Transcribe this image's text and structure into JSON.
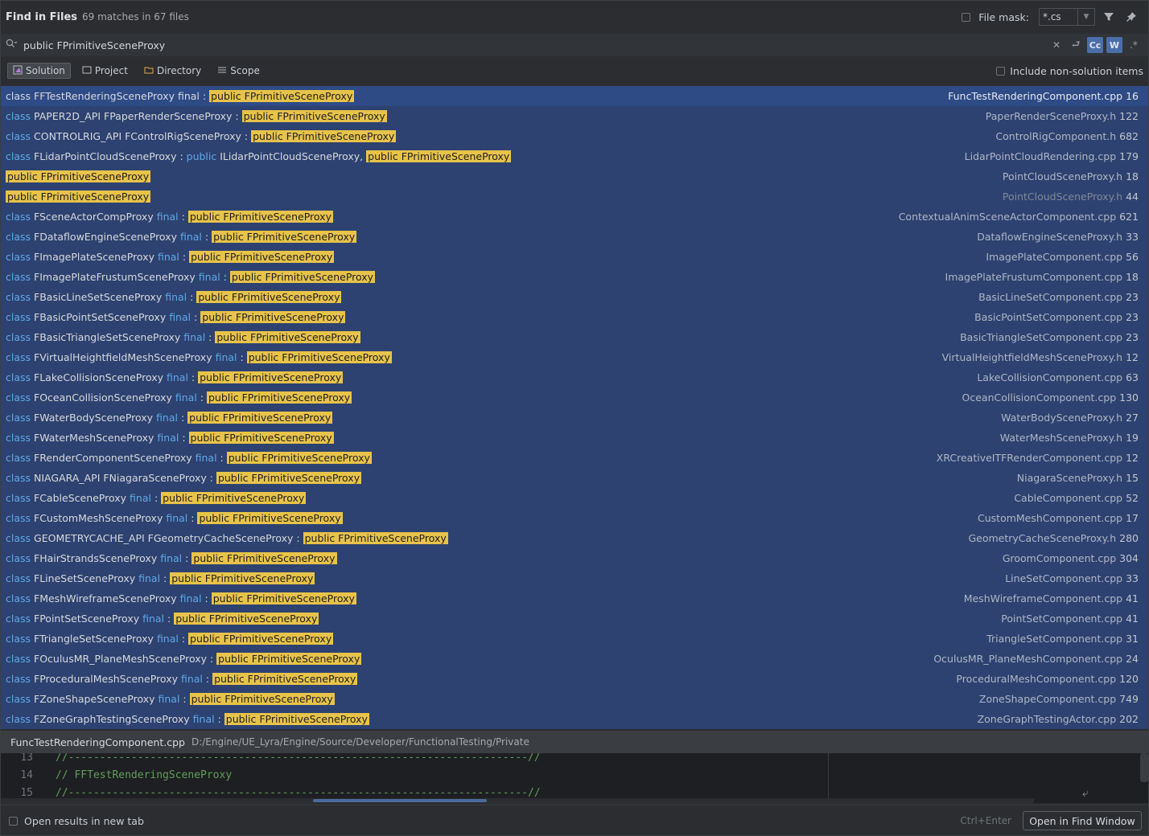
{
  "header": {
    "title": "Find in Files",
    "match_count": "69 matches in 67 files",
    "file_mask_label": "File mask:",
    "file_mask_value": "*.cs"
  },
  "search": {
    "query": "public FPrimitiveSceneProxy",
    "case_toggle": "Cc",
    "words_toggle": "W",
    "regex_toggle": ".*"
  },
  "scopes": [
    {
      "label": "Solution",
      "active": true,
      "icon": "solution-icon"
    },
    {
      "label": "Project",
      "active": false,
      "icon": "project-icon"
    },
    {
      "label": "Directory",
      "active": false,
      "icon": "folder-icon"
    },
    {
      "label": "Scope",
      "active": false,
      "icon": "scope-icon"
    }
  ],
  "include_non_solution": "Include non-solution items",
  "highlight": "public FPrimitiveSceneProxy",
  "results": [
    {
      "pre": [
        [
          "class ",
          "p"
        ],
        [
          "FFTestRenderingSceneProxy final : ",
          "p"
        ]
      ],
      "post": [],
      "file": "FuncTestRenderingComponent.cpp",
      "line": "16",
      "selected": true
    },
    {
      "pre": [
        [
          "class ",
          "k"
        ],
        [
          "PAPER2D_API FPaperRenderSceneProxy : ",
          "p"
        ]
      ],
      "post": [],
      "file": "PaperRenderSceneProxy.h",
      "line": "122"
    },
    {
      "pre": [
        [
          "class ",
          "k"
        ],
        [
          "CONTROLRIG_API FControlRigSceneProxy : ",
          "p"
        ]
      ],
      "post": [],
      "file": "ControlRigComponent.h",
      "line": "682"
    },
    {
      "pre": [
        [
          "class ",
          "k"
        ],
        [
          "FLidarPointCloudSceneProxy : ",
          "p"
        ],
        [
          "public ",
          "k"
        ],
        [
          "ILidarPointCloudSceneProxy, ",
          "p"
        ]
      ],
      "post": [],
      "file": "LidarPointCloudRendering.cpp",
      "line": "179"
    },
    {
      "pre": [],
      "post": [],
      "file": "PointCloudSceneProxy.h",
      "line": "18"
    },
    {
      "pre": [],
      "post": [],
      "file": "PointCloudSceneProxy.h",
      "line": "44",
      "dim": true
    },
    {
      "pre": [
        [
          "class ",
          "k"
        ],
        [
          "FSceneActorCompProxy ",
          "p"
        ],
        [
          "final",
          "k"
        ],
        [
          " : ",
          "p"
        ]
      ],
      "post": [],
      "file": "ContextualAnimSceneActorComponent.cpp",
      "line": "621"
    },
    {
      "pre": [
        [
          "class ",
          "k"
        ],
        [
          "FDataflowEngineSceneProxy ",
          "p"
        ],
        [
          "final",
          "k"
        ],
        [
          " : ",
          "p"
        ]
      ],
      "post": [],
      "file": "DataflowEngineSceneProxy.h",
      "line": "33"
    },
    {
      "pre": [
        [
          "class ",
          "k"
        ],
        [
          "FImagePlateSceneProxy ",
          "p"
        ],
        [
          "final",
          "k"
        ],
        [
          " : ",
          "p"
        ]
      ],
      "post": [],
      "file": "ImagePlateComponent.cpp",
      "line": "56"
    },
    {
      "pre": [
        [
          "class ",
          "k"
        ],
        [
          "FImagePlateFrustumSceneProxy ",
          "p"
        ],
        [
          "final",
          "k"
        ],
        [
          " : ",
          "p"
        ]
      ],
      "post": [],
      "file": "ImagePlateFrustumComponent.cpp",
      "line": "18"
    },
    {
      "pre": [
        [
          "class ",
          "k"
        ],
        [
          "FBasicLineSetSceneProxy ",
          "p"
        ],
        [
          "final",
          "k"
        ],
        [
          " : ",
          "p"
        ]
      ],
      "post": [],
      "file": "BasicLineSetComponent.cpp",
      "line": "23"
    },
    {
      "pre": [
        [
          "class ",
          "k"
        ],
        [
          "FBasicPointSetSceneProxy ",
          "p"
        ],
        [
          "final",
          "k"
        ],
        [
          " : ",
          "p"
        ]
      ],
      "post": [],
      "file": "BasicPointSetComponent.cpp",
      "line": "23"
    },
    {
      "pre": [
        [
          "class ",
          "k"
        ],
        [
          "FBasicTriangleSetSceneProxy ",
          "p"
        ],
        [
          "final",
          "k"
        ],
        [
          " : ",
          "p"
        ]
      ],
      "post": [],
      "file": "BasicTriangleSetComponent.cpp",
      "line": "23"
    },
    {
      "pre": [
        [
          "class ",
          "k"
        ],
        [
          "FVirtualHeightfieldMeshSceneProxy ",
          "p"
        ],
        [
          "final",
          "k"
        ],
        [
          " : ",
          "p"
        ]
      ],
      "post": [],
      "file": "VirtualHeightfieldMeshSceneProxy.h",
      "line": "12"
    },
    {
      "pre": [
        [
          "class ",
          "k"
        ],
        [
          "FLakeCollisionSceneProxy ",
          "p"
        ],
        [
          "final",
          "k"
        ],
        [
          " : ",
          "p"
        ]
      ],
      "post": [],
      "file": "LakeCollisionComponent.cpp",
      "line": "63"
    },
    {
      "pre": [
        [
          "class ",
          "k"
        ],
        [
          "FOceanCollisionSceneProxy ",
          "p"
        ],
        [
          "final",
          "k"
        ],
        [
          " : ",
          "p"
        ]
      ],
      "post": [],
      "file": "OceanCollisionComponent.cpp",
      "line": "130"
    },
    {
      "pre": [
        [
          "class ",
          "k"
        ],
        [
          "FWaterBodySceneProxy ",
          "p"
        ],
        [
          "final",
          "k"
        ],
        [
          " : ",
          "p"
        ]
      ],
      "post": [],
      "file": "WaterBodySceneProxy.h",
      "line": "27"
    },
    {
      "pre": [
        [
          "class ",
          "k"
        ],
        [
          "FWaterMeshSceneProxy ",
          "p"
        ],
        [
          "final",
          "k"
        ],
        [
          " : ",
          "p"
        ]
      ],
      "post": [],
      "file": "WaterMeshSceneProxy.h",
      "line": "19"
    },
    {
      "pre": [
        [
          "class ",
          "k"
        ],
        [
          "FRenderComponentSceneProxy ",
          "p"
        ],
        [
          "final",
          "k"
        ],
        [
          " : ",
          "p"
        ]
      ],
      "post": [],
      "file": "XRCreativeITFRenderComponent.cpp",
      "line": "12"
    },
    {
      "pre": [
        [
          "class ",
          "k"
        ],
        [
          "NIAGARA_API FNiagaraSceneProxy : ",
          "p"
        ]
      ],
      "post": [],
      "file": "NiagaraSceneProxy.h",
      "line": "15"
    },
    {
      "pre": [
        [
          "class ",
          "k"
        ],
        [
          "FCableSceneProxy ",
          "p"
        ],
        [
          "final",
          "k"
        ],
        [
          " : ",
          "p"
        ]
      ],
      "post": [],
      "file": "CableComponent.cpp",
      "line": "52"
    },
    {
      "pre": [
        [
          "class ",
          "k"
        ],
        [
          "FCustomMeshSceneProxy ",
          "p"
        ],
        [
          "final",
          "k"
        ],
        [
          " : ",
          "p"
        ]
      ],
      "post": [],
      "file": "CustomMeshComponent.cpp",
      "line": "17"
    },
    {
      "pre": [
        [
          "class ",
          "k"
        ],
        [
          "GEOMETRYCACHE_API FGeometryCacheSceneProxy : ",
          "p"
        ]
      ],
      "post": [],
      "file": "GeometryCacheSceneProxy.h",
      "line": "280"
    },
    {
      "pre": [
        [
          "class ",
          "k"
        ],
        [
          "FHairStrandsSceneProxy ",
          "p"
        ],
        [
          "final",
          "k"
        ],
        [
          " : ",
          "p"
        ]
      ],
      "post": [],
      "file": "GroomComponent.cpp",
      "line": "304"
    },
    {
      "pre": [
        [
          "class ",
          "k"
        ],
        [
          "FLineSetSceneProxy ",
          "p"
        ],
        [
          "final",
          "k"
        ],
        [
          " : ",
          "p"
        ]
      ],
      "post": [],
      "file": "LineSetComponent.cpp",
      "line": "33"
    },
    {
      "pre": [
        [
          "class ",
          "k"
        ],
        [
          "FMeshWireframeSceneProxy ",
          "p"
        ],
        [
          "final",
          "k"
        ],
        [
          " : ",
          "p"
        ]
      ],
      "post": [],
      "file": "MeshWireframeComponent.cpp",
      "line": "41"
    },
    {
      "pre": [
        [
          "class ",
          "k"
        ],
        [
          "FPointSetSceneProxy ",
          "p"
        ],
        [
          "final",
          "k"
        ],
        [
          " : ",
          "p"
        ]
      ],
      "post": [],
      "file": "PointSetComponent.cpp",
      "line": "41"
    },
    {
      "pre": [
        [
          "class ",
          "k"
        ],
        [
          "FTriangleSetSceneProxy ",
          "p"
        ],
        [
          "final",
          "k"
        ],
        [
          " : ",
          "p"
        ]
      ],
      "post": [],
      "file": "TriangleSetComponent.cpp",
      "line": "31"
    },
    {
      "pre": [
        [
          "class ",
          "k"
        ],
        [
          "FOculusMR_PlaneMeshSceneProxy : ",
          "p"
        ]
      ],
      "post": [],
      "file": "OculusMR_PlaneMeshComponent.cpp",
      "line": "24"
    },
    {
      "pre": [
        [
          "class ",
          "k"
        ],
        [
          "FProceduralMeshSceneProxy ",
          "p"
        ],
        [
          "final",
          "k"
        ],
        [
          " : ",
          "p"
        ]
      ],
      "post": [],
      "file": "ProceduralMeshComponent.cpp",
      "line": "120"
    },
    {
      "pre": [
        [
          "class ",
          "k"
        ],
        [
          "FZoneShapeSceneProxy ",
          "p"
        ],
        [
          "final",
          "k"
        ],
        [
          " : ",
          "p"
        ]
      ],
      "post": [],
      "file": "ZoneShapeComponent.cpp",
      "line": "749"
    },
    {
      "pre": [
        [
          "class ",
          "k"
        ],
        [
          "FZoneGraphTestingSceneProxy ",
          "p"
        ],
        [
          "final",
          "k"
        ],
        [
          " : ",
          "p"
        ]
      ],
      "post": [],
      "file": "ZoneGraphTestingActor.cpp",
      "line": "202"
    }
  ],
  "preview": {
    "file": "FuncTestRenderingComponent.cpp",
    "path": "D:/Engine/UE_Lyra/Engine/Source/Developer/FunctionalTesting/Private",
    "lines": [
      {
        "num": "13",
        "text": "//-------------------------------------------------------------------------//"
      },
      {
        "num": "14",
        "text": "// FFTestRenderingSceneProxy"
      },
      {
        "num": "15",
        "text": "//-------------------------------------------------------------------------//"
      }
    ]
  },
  "footer": {
    "open_new_tab": "Open results in new tab",
    "shortcut": "Ctrl+Enter",
    "open_button": "Open in Find Window"
  },
  "colors": {
    "accent": "#2e4b86",
    "highlight": "#e8c34a",
    "keyword": "#5fa8e8",
    "comment": "#5f9e5a"
  }
}
